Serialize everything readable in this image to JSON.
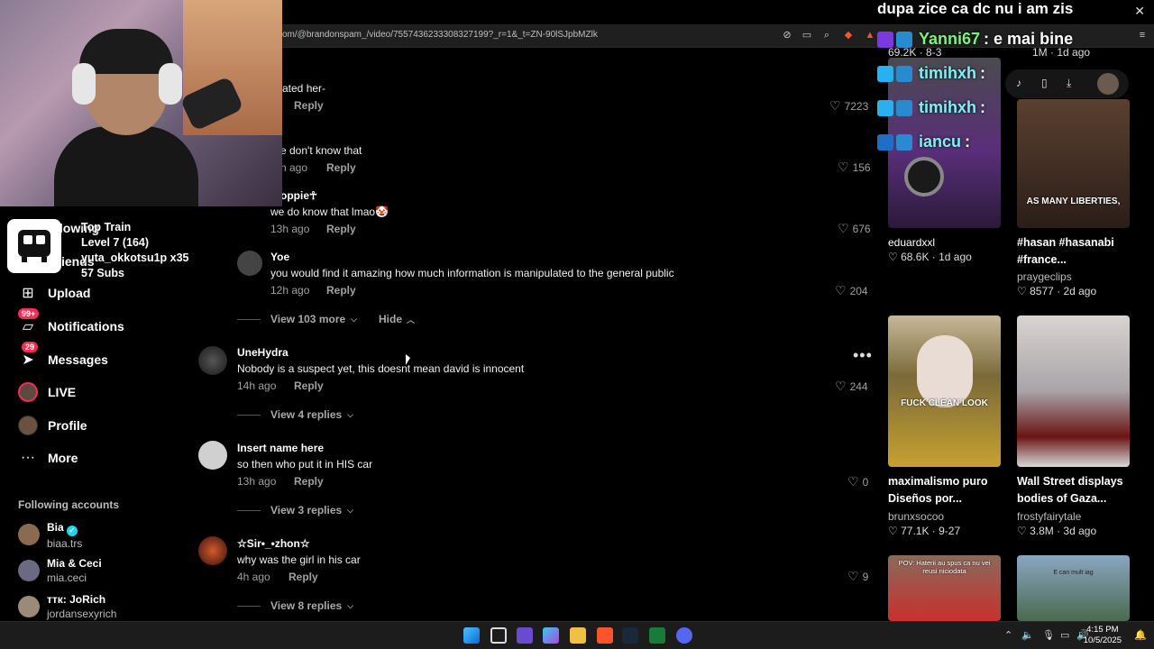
{
  "browser": {
    "url": "om/@brandonspam_/video/7557436233308327199?_r=1&_t=ZN-90lSJpbMZlk",
    "close": "✕"
  },
  "stream_overlay": {
    "top_message": "dupa zice ca dc nu i am zis",
    "chat": [
      {
        "name": "Yanni67",
        "message": ": e mai bine",
        "name_color": "#7cf27c"
      },
      {
        "name": "timihxh",
        "message": ":",
        "name_color": "#7cf2f2"
      },
      {
        "name": "timihxh",
        "message": ":",
        "name_color": "#7cf2f2"
      },
      {
        "name": "iancu",
        "message": ":",
        "name_color": "#7cf2f2"
      }
    ],
    "sub_card": {
      "title": "Top Train",
      "level": "Level 7  (164)",
      "user": "yuta_okkotsu1p x35",
      "subs": "57 Subs"
    }
  },
  "sidebar": {
    "behind_following": "llowing",
    "behind_friends": "iends",
    "items": [
      {
        "label": "Upload",
        "icon": "plus-square-icon"
      },
      {
        "label": "Notifications",
        "icon": "inbox-icon",
        "badge": "99+"
      },
      {
        "label": "Messages",
        "icon": "send-icon",
        "badge": "29"
      },
      {
        "label": "LIVE",
        "icon": "live-icon"
      },
      {
        "label": "Profile",
        "icon": "avatar-icon"
      },
      {
        "label": "More",
        "icon": "more-icon"
      }
    ],
    "following_title": "Following accounts",
    "following": [
      {
        "name": "Bia",
        "user": "biaa.trs",
        "verified": true
      },
      {
        "name": "Mia & Ceci",
        "user": "mia.ceci"
      },
      {
        "name": "ттк: JoRich",
        "user": "jordansexyrich"
      }
    ]
  },
  "comments": {
    "c1": {
      "text": "ated her-",
      "reply": "Reply",
      "likes": "7223"
    },
    "c2": {
      "text": "e don't know that",
      "time": "h ago",
      "reply": "Reply",
      "likes": "156"
    },
    "c3": {
      "user": "oppie☥",
      "text": "we do know that lmao🤡",
      "time": "13h ago",
      "reply": "Reply",
      "likes": "676"
    },
    "c4": {
      "user": "Yoe",
      "text": "you would find it amazing how much information is manipulated to the general public",
      "time": "12h ago",
      "reply": "Reply",
      "likes": "204"
    },
    "view_more_1": "View 103 more",
    "hide": "Hide",
    "c5": {
      "user": "UneHydra",
      "text": "Nobody is a suspect yet, this doesnt mean david is innocent",
      "time": "14h ago",
      "reply": "Reply",
      "likes": "244"
    },
    "view_replies_5": "View 4 replies",
    "c6": {
      "user": "Insert name here",
      "text": "so then who put it in HIS car",
      "time": "13h ago",
      "reply": "Reply",
      "likes": "0"
    },
    "view_replies_6": "View 3 replies",
    "c7": {
      "user": "☆Sir•_•zhon☆",
      "text": "why was the girl in his car",
      "time": "4h ago",
      "reply": "Reply",
      "likes": "9"
    },
    "view_replies_7": "View 8 replies"
  },
  "videos": {
    "top_left_stats": "69.2K · 8-3",
    "top_right_stats": "1M · 1d ago",
    "v1": {
      "user": "eduardxxl",
      "stats": "68.6K · 1d ago",
      "color": "#3a2a55"
    },
    "v2": {
      "title1": "#hasan #hasanabi",
      "title2": "#france...",
      "user": "praygeclips",
      "stats": "8577 · 2d ago",
      "overlay": "AS MANY LIBERTIES,",
      "color": "#3b2d22"
    },
    "v3": {
      "title1": "maximalismo puro",
      "title2": "Diseños por...",
      "user": "brunxsocoo",
      "stats": "77.1K · 9-27",
      "overlay": "FUCK CLEAN LOOK",
      "color": "#8a7a3a"
    },
    "v4": {
      "title1": "Wall Street displays",
      "title2": "bodies of Gaza...",
      "user": "frostyfairytale",
      "stats": "3.8M · 3d ago",
      "color": "#c9c0c0"
    },
    "v5": {
      "overlay": "POV: Haterii au spus ca nu vei reusi niciodata",
      "color": "#5a3a3a"
    },
    "v6": {
      "overlay": "E can mult iag",
      "color": "#6e8aa0"
    }
  },
  "taskbar": {
    "time": "4:15 PM",
    "date": "10/5/2025"
  }
}
